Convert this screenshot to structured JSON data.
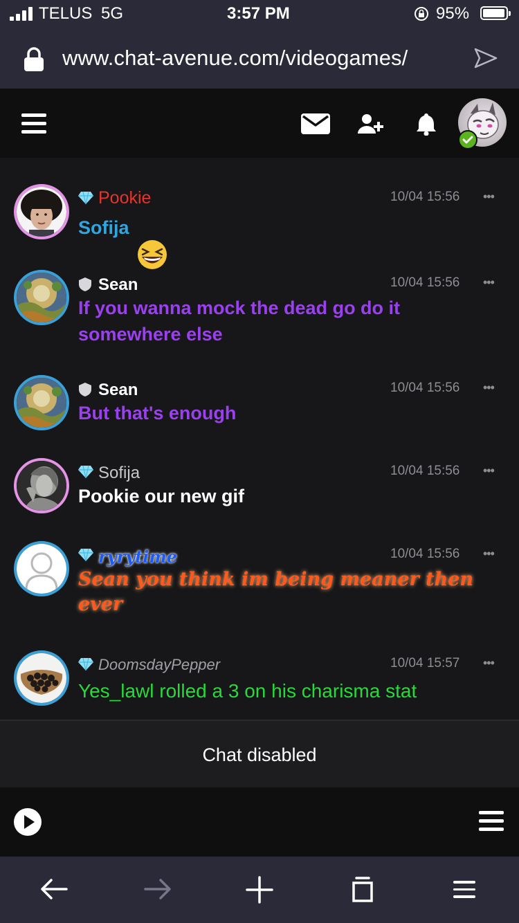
{
  "status_bar": {
    "carrier": "TELUS",
    "network": "5G",
    "time": "3:57 PM",
    "battery": "95%"
  },
  "url_bar": {
    "url": "www.chat-avenue.com/videogames/"
  },
  "header": {
    "icons": [
      "menu-icon",
      "mail-icon",
      "add-friend-icon",
      "bell-icon"
    ]
  },
  "messages": [
    {
      "user": "Pookie",
      "user_color": "#e8322a",
      "rank": "diamond",
      "time": "10/04 15:56",
      "text": "Sofija",
      "text_color": "#2fa6e0",
      "emoji": "laughing-emoji"
    },
    {
      "user": "Sean",
      "user_color": "#ffffff",
      "rank": "shield",
      "time": "10/04 15:56",
      "text": "If you wanna mock the dead go do it somewhere else",
      "text_color": "#9a40ef"
    },
    {
      "user": "Sean",
      "user_color": "#ffffff",
      "rank": "shield",
      "time": "10/04 15:56",
      "text": "But that's enough",
      "text_color": "#9a40ef"
    },
    {
      "user": "Sofija",
      "user_color": "#c8c8c8",
      "rank": "diamond",
      "time": "10/04 15:56",
      "text": "Pookie our new gif",
      "text_color": "#ffffff"
    },
    {
      "user": "ryrytime",
      "user_color": "#1d5cf0",
      "rank": "diamond",
      "time": "10/04 15:56",
      "text": "Sean you think im being meaner then ever",
      "text_color": "#ff5a1c"
    },
    {
      "user": "DoomsdayPepper",
      "user_color": "#a0a0a6",
      "rank": "diamond",
      "time": "10/04 15:57",
      "text": "Yes_lawl rolled a 3 on his charisma stat",
      "text_color": "#27d93a"
    }
  ],
  "chat_disabled": "Chat disabled",
  "colors": {
    "background": "#171719",
    "browser_chrome": "#2b2a38",
    "header": "#0f0f10"
  }
}
